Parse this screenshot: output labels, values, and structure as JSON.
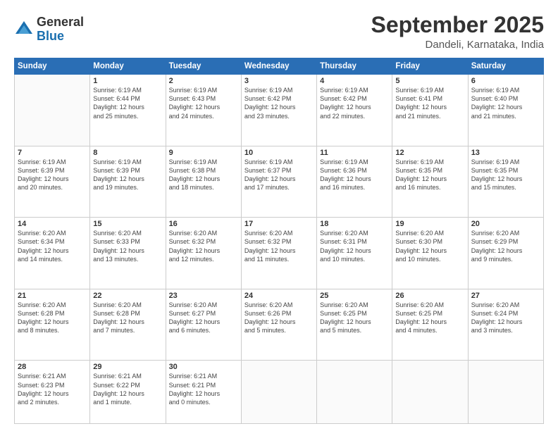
{
  "logo": {
    "general": "General",
    "blue": "Blue"
  },
  "title": "September 2025",
  "location": "Dandeli, Karnataka, India",
  "days_header": [
    "Sunday",
    "Monday",
    "Tuesday",
    "Wednesday",
    "Thursday",
    "Friday",
    "Saturday"
  ],
  "weeks": [
    [
      {
        "num": "",
        "info": ""
      },
      {
        "num": "1",
        "info": "Sunrise: 6:19 AM\nSunset: 6:44 PM\nDaylight: 12 hours\nand 25 minutes."
      },
      {
        "num": "2",
        "info": "Sunrise: 6:19 AM\nSunset: 6:43 PM\nDaylight: 12 hours\nand 24 minutes."
      },
      {
        "num": "3",
        "info": "Sunrise: 6:19 AM\nSunset: 6:42 PM\nDaylight: 12 hours\nand 23 minutes."
      },
      {
        "num": "4",
        "info": "Sunrise: 6:19 AM\nSunset: 6:42 PM\nDaylight: 12 hours\nand 22 minutes."
      },
      {
        "num": "5",
        "info": "Sunrise: 6:19 AM\nSunset: 6:41 PM\nDaylight: 12 hours\nand 21 minutes."
      },
      {
        "num": "6",
        "info": "Sunrise: 6:19 AM\nSunset: 6:40 PM\nDaylight: 12 hours\nand 21 minutes."
      }
    ],
    [
      {
        "num": "7",
        "info": "Sunrise: 6:19 AM\nSunset: 6:39 PM\nDaylight: 12 hours\nand 20 minutes."
      },
      {
        "num": "8",
        "info": "Sunrise: 6:19 AM\nSunset: 6:39 PM\nDaylight: 12 hours\nand 19 minutes."
      },
      {
        "num": "9",
        "info": "Sunrise: 6:19 AM\nSunset: 6:38 PM\nDaylight: 12 hours\nand 18 minutes."
      },
      {
        "num": "10",
        "info": "Sunrise: 6:19 AM\nSunset: 6:37 PM\nDaylight: 12 hours\nand 17 minutes."
      },
      {
        "num": "11",
        "info": "Sunrise: 6:19 AM\nSunset: 6:36 PM\nDaylight: 12 hours\nand 16 minutes."
      },
      {
        "num": "12",
        "info": "Sunrise: 6:19 AM\nSunset: 6:35 PM\nDaylight: 12 hours\nand 16 minutes."
      },
      {
        "num": "13",
        "info": "Sunrise: 6:19 AM\nSunset: 6:35 PM\nDaylight: 12 hours\nand 15 minutes."
      }
    ],
    [
      {
        "num": "14",
        "info": "Sunrise: 6:20 AM\nSunset: 6:34 PM\nDaylight: 12 hours\nand 14 minutes."
      },
      {
        "num": "15",
        "info": "Sunrise: 6:20 AM\nSunset: 6:33 PM\nDaylight: 12 hours\nand 13 minutes."
      },
      {
        "num": "16",
        "info": "Sunrise: 6:20 AM\nSunset: 6:32 PM\nDaylight: 12 hours\nand 12 minutes."
      },
      {
        "num": "17",
        "info": "Sunrise: 6:20 AM\nSunset: 6:32 PM\nDaylight: 12 hours\nand 11 minutes."
      },
      {
        "num": "18",
        "info": "Sunrise: 6:20 AM\nSunset: 6:31 PM\nDaylight: 12 hours\nand 10 minutes."
      },
      {
        "num": "19",
        "info": "Sunrise: 6:20 AM\nSunset: 6:30 PM\nDaylight: 12 hours\nand 10 minutes."
      },
      {
        "num": "20",
        "info": "Sunrise: 6:20 AM\nSunset: 6:29 PM\nDaylight: 12 hours\nand 9 minutes."
      }
    ],
    [
      {
        "num": "21",
        "info": "Sunrise: 6:20 AM\nSunset: 6:28 PM\nDaylight: 12 hours\nand 8 minutes."
      },
      {
        "num": "22",
        "info": "Sunrise: 6:20 AM\nSunset: 6:28 PM\nDaylight: 12 hours\nand 7 minutes."
      },
      {
        "num": "23",
        "info": "Sunrise: 6:20 AM\nSunset: 6:27 PM\nDaylight: 12 hours\nand 6 minutes."
      },
      {
        "num": "24",
        "info": "Sunrise: 6:20 AM\nSunset: 6:26 PM\nDaylight: 12 hours\nand 5 minutes."
      },
      {
        "num": "25",
        "info": "Sunrise: 6:20 AM\nSunset: 6:25 PM\nDaylight: 12 hours\nand 5 minutes."
      },
      {
        "num": "26",
        "info": "Sunrise: 6:20 AM\nSunset: 6:25 PM\nDaylight: 12 hours\nand 4 minutes."
      },
      {
        "num": "27",
        "info": "Sunrise: 6:20 AM\nSunset: 6:24 PM\nDaylight: 12 hours\nand 3 minutes."
      }
    ],
    [
      {
        "num": "28",
        "info": "Sunrise: 6:21 AM\nSunset: 6:23 PM\nDaylight: 12 hours\nand 2 minutes."
      },
      {
        "num": "29",
        "info": "Sunrise: 6:21 AM\nSunset: 6:22 PM\nDaylight: 12 hours\nand 1 minute."
      },
      {
        "num": "30",
        "info": "Sunrise: 6:21 AM\nSunset: 6:21 PM\nDaylight: 12 hours\nand 0 minutes."
      },
      {
        "num": "",
        "info": ""
      },
      {
        "num": "",
        "info": ""
      },
      {
        "num": "",
        "info": ""
      },
      {
        "num": "",
        "info": ""
      }
    ]
  ]
}
